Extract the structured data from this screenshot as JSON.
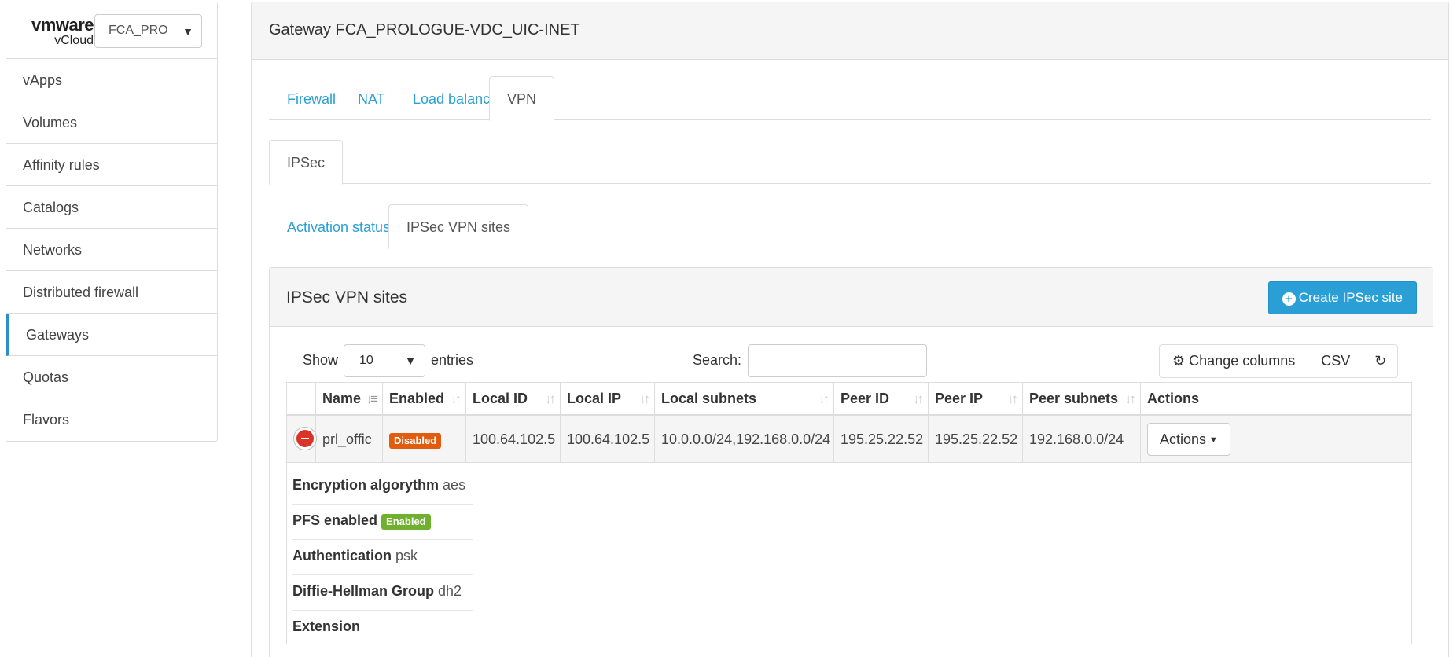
{
  "sidebar": {
    "brand": {
      "vmware": "vmware",
      "vcloud": "vCloud"
    },
    "org_select": "FCA_PRO",
    "items": [
      {
        "label": "vApps"
      },
      {
        "label": "Volumes"
      },
      {
        "label": "Affinity rules"
      },
      {
        "label": "Catalogs"
      },
      {
        "label": "Networks"
      },
      {
        "label": "Distributed firewall"
      },
      {
        "label": "Gateways",
        "active": true
      },
      {
        "label": "Quotas"
      },
      {
        "label": "Flavors"
      }
    ]
  },
  "header": {
    "title": "Gateway FCA_PROLOGUE-VDC_UIC-INET"
  },
  "tabs_primary": [
    "Firewall",
    "NAT",
    "Load balancer",
    "VPN"
  ],
  "tabs_vpn": [
    "IPSec"
  ],
  "tabs_ipsec": [
    "Activation status",
    "IPSec VPN sites"
  ],
  "panel": {
    "title": "IPSec VPN sites",
    "create_button": "Create IPSec site",
    "show_label": "Show",
    "page_length": "10",
    "entries_label": "entries",
    "search_label": "Search:",
    "search_value": "",
    "change_columns": "Change columns",
    "csv": "CSV"
  },
  "table": {
    "columns": [
      "Name",
      "Enabled",
      "Local ID",
      "Local IP",
      "Local subnets",
      "Peer ID",
      "Peer IP",
      "Peer subnets",
      "Actions"
    ],
    "rows": [
      {
        "name": "prl_offic",
        "enabled": "Disabled",
        "local_id": "100.64.102.5",
        "local_ip": "100.64.102.5",
        "local_subnets": "10.0.0.0/24,192.168.0.0/24",
        "peer_id": "195.25.22.52",
        "peer_ip": "195.25.22.52",
        "peer_subnets": "192.168.0.0/24",
        "actions": "Actions"
      }
    ],
    "details": {
      "encryption_label": "Encryption algorythm",
      "encryption_value": "aes",
      "pfs_label": "PFS enabled",
      "pfs_value": "Enabled",
      "auth_label": "Authentication",
      "auth_value": "psk",
      "dh_label": "Diffie-Hellman Group",
      "dh_value": "dh2",
      "extension_label": "Extension"
    }
  },
  "colors": {
    "accent": "#2a9fd6",
    "disabled_badge": "#e15c0e",
    "enabled_badge": "#6fb02e",
    "remove": "#d9332a"
  }
}
